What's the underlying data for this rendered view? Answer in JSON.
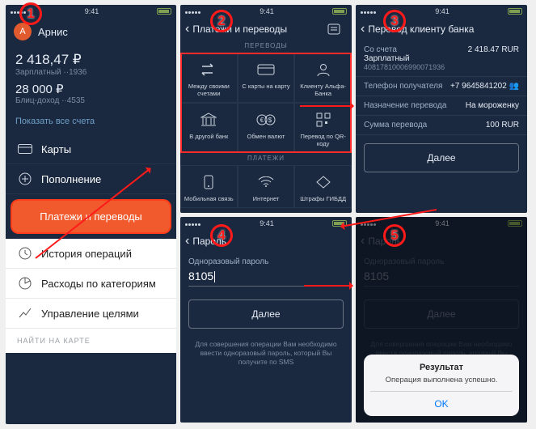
{
  "status": {
    "time": "9:41"
  },
  "steps": {
    "s1": "1",
    "s2": "2",
    "s3": "3",
    "s4": "4",
    "s5": "5"
  },
  "p1": {
    "avatar_letter": "A",
    "username": "Арнис",
    "acc1_amount": "2 418,47 ₽",
    "acc1_label": "Зарплатный",
    "acc1_id": "··1936",
    "acc2_amount": "28 000 ₽",
    "acc2_label": "Блиц-доход",
    "acc2_id": "··4535",
    "show_all": "Показать все счета",
    "menu_cards": "Карты",
    "menu_topup": "Пополнение",
    "menu_pay": "Платежи и переводы",
    "menu_history": "История операций",
    "menu_expenses": "Расходы по категориям",
    "menu_goals": "Управление целями",
    "find_map": "НАЙТИ НА КАРТЕ"
  },
  "p2": {
    "title": "Платежи и переводы",
    "section_transfers": "ПЕРЕВОДЫ",
    "section_payments": "ПЛАТЕЖИ",
    "cells": [
      "Между своими счетами",
      "С карты на карту",
      "Клиенту Альфа-Банка",
      "В другой банк",
      "Обмен валют",
      "Перевод по QR-коду",
      "Мобильная связь",
      "Интернет",
      "Штрафы ГИБДД"
    ]
  },
  "p3": {
    "title": "Перевод клиенту банка",
    "from_label": "Со счета",
    "from_name": "Зарплатный",
    "from_number": "40817810006990071936",
    "from_balance": "2 418.47 RUR",
    "phone_label": "Телефон получателя",
    "phone_value": "+7 9645841202",
    "purpose_label": "Назначение перевода",
    "purpose_value": "На мороженку",
    "amount_label": "Сумма перевода",
    "amount_value": "100 RUR",
    "next": "Далее"
  },
  "p4": {
    "title": "Пароль",
    "input_label": "Одноразовый пароль",
    "input_value": "8105",
    "next": "Далее",
    "hint": "Для совершения операции Вам необходимо ввести одноразовый пароль, который Вы получите по SMS"
  },
  "p5": {
    "title": "Пароль",
    "input_label": "Одноразовый пароль",
    "input_value": "8105",
    "next": "Далее",
    "hint": "Для совершения операции Вам необходимо ввести одноразовый пароль, который Вы получите по SMS",
    "alert_title": "Результат",
    "alert_msg": "Операция выполнена успешно.",
    "alert_ok": "OK"
  }
}
